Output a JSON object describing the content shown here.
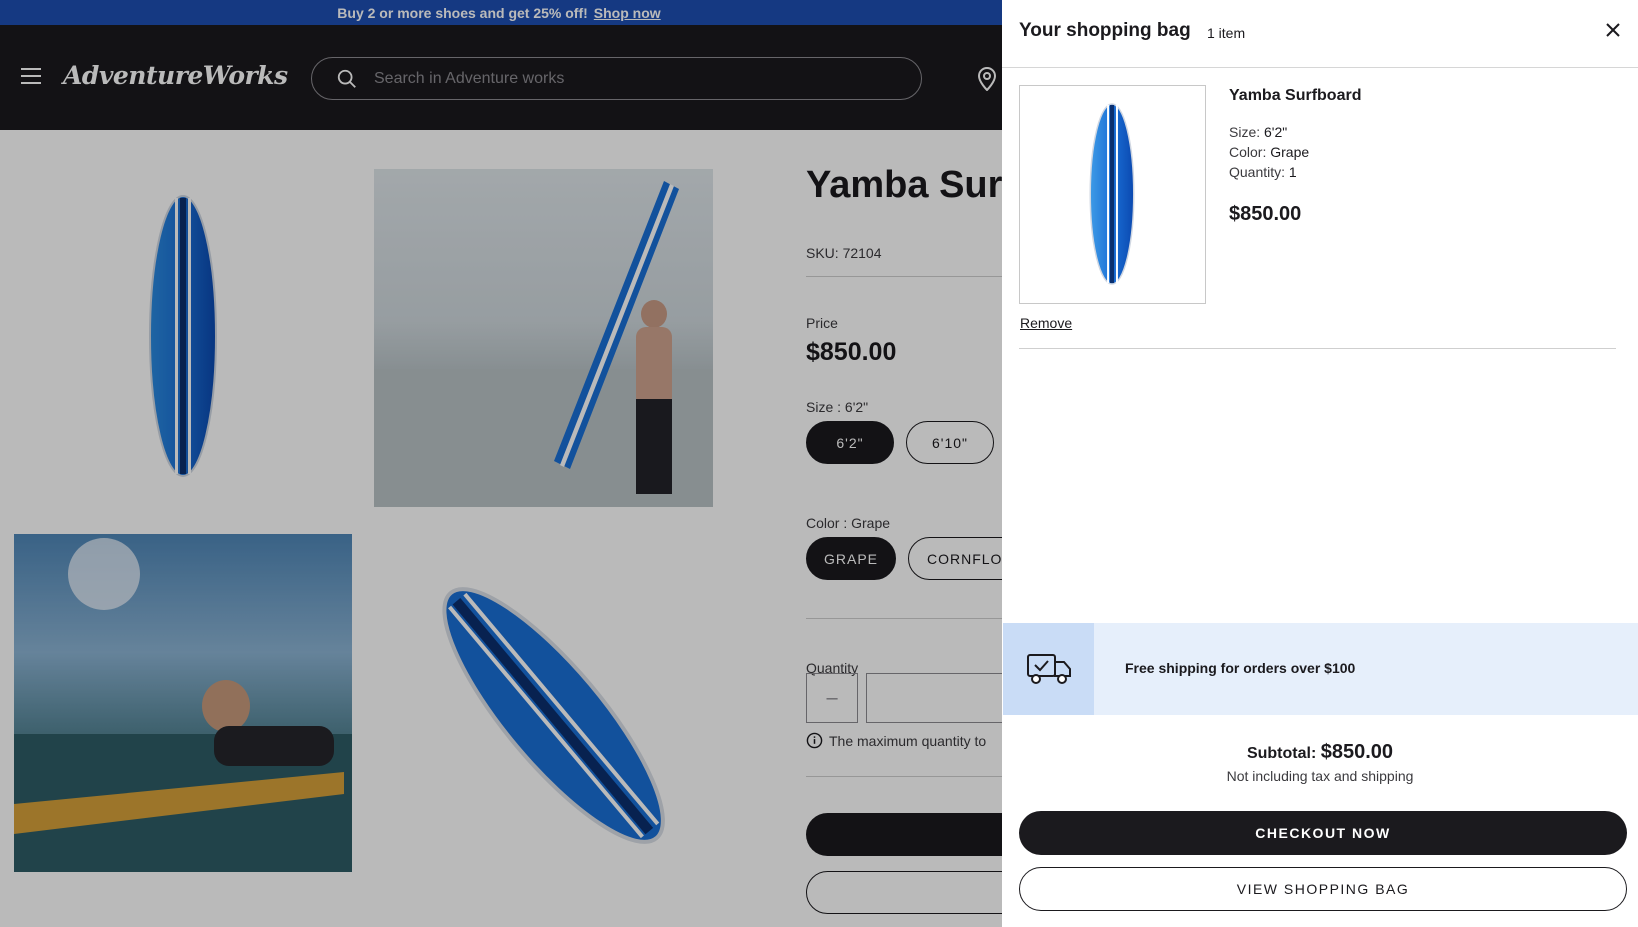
{
  "promo": {
    "text": "Buy 2 or more shoes and get 25% off!",
    "link": "Shop now"
  },
  "header": {
    "logo": "AdventureWorks",
    "search_placeholder": "Search in Adventure works"
  },
  "product": {
    "title": "Yamba Surfboard",
    "sku": "SKU: 72104",
    "price_label": "Price",
    "price": "$850.00",
    "size_label": "Size : 6'2\"",
    "sizes": [
      "6'2\"",
      "6'10\""
    ],
    "color_label": "Color : Grape",
    "colors": [
      "GRAPE",
      "CORNFLOWER"
    ],
    "quantity_label": "Quantity",
    "quantity_minus": "–",
    "quantity_note": "The maximum quantity to"
  },
  "drawer": {
    "title": "Your shopping bag",
    "count": "1 item",
    "item": {
      "name": "Yamba Surfboard",
      "size_label": "Size:",
      "size_value": "6'2\"",
      "color_label": "Color:",
      "color_value": "Grape",
      "quantity_label": "Quantity:",
      "quantity_value": "1",
      "price": "$850.00",
      "remove": "Remove"
    },
    "shipping_text": "Free shipping for orders over $100",
    "subtotal_label": "Subtotal:",
    "subtotal_value": "$850.00",
    "subtotal_note": "Not including tax and shipping",
    "checkout": "CHECKOUT NOW",
    "view_bag": "VIEW SHOPPING BAG"
  },
  "colors": {
    "header_bg": "#1b1a1e",
    "promo_bg": "#1e4fb3",
    "shipping_bg": "#e6effb",
    "board_blue": "#1a6fd6"
  }
}
